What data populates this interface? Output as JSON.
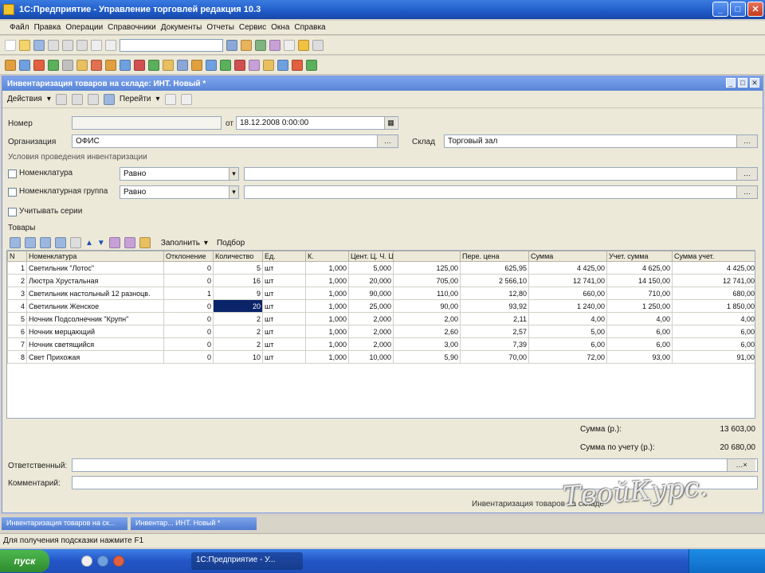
{
  "window": {
    "title": "1С:Предприятие - Управление торговлей редакция 10.3"
  },
  "menu": [
    "Файл",
    "Правка",
    "Операции",
    "Справочники",
    "Документы",
    "Отчеты",
    "Сервис",
    "Окна",
    "Справка"
  ],
  "doc": {
    "title": "Инвентаризация товаров на складе: ИНТ. Новый *",
    "actions_label": "Действия",
    "goto_label": "Перейти",
    "number_label": "Номер",
    "number_value": "",
    "date_prefix": "от",
    "date_value": "18.12.2008 0:00:00",
    "org_label": "Организация",
    "org_value": "ОФИС",
    "warehouse_label": "Склад",
    "warehouse_value": "Торговый зал",
    "section_conditions": "Условия проведения инвентаризации",
    "cond_nomenclature_label": "Номенклатура",
    "cond_nomenclature_mode": "Равно",
    "cond_group_label": "Номенклатурная группа",
    "cond_group_mode": "Равно",
    "cond_series_label": "Учитывать серии",
    "goods_label": "Товары",
    "fill_label": "Заполнить",
    "select_label": "Подбор"
  },
  "table": {
    "columns": [
      "N",
      "Номенклатура",
      "Отклонение",
      "Количество",
      "Ед.",
      "К.",
      "Цент. Ц. Ч. Цена",
      "",
      "Пере. цена",
      "Сумма",
      "Учет. сумма",
      "Сумма учет."
    ],
    "rows": [
      [
        "1",
        "Светильник \"Лотос\"",
        "0",
        "5",
        "шт",
        "1,000",
        "5,000",
        "125,00",
        "625,95",
        "4 425,00",
        "4 625,00",
        "4 425,00"
      ],
      [
        "2",
        "Люстра Хрустальная",
        "0",
        "16",
        "шт",
        "1,000",
        "20,000",
        "705,00",
        "2 566,10",
        "12 741,00",
        "14 150,00",
        "12 741,00"
      ],
      [
        "3",
        "Светильник настольный 12 разноцв.",
        "1",
        "9",
        "шт",
        "1,000",
        "90,000",
        "110,00",
        "12,80",
        "660,00",
        "710,00",
        "680,00"
      ],
      [
        "4",
        "Светильник Женское",
        "0",
        "20",
        "шт",
        "1,000",
        "25,000",
        "90,00",
        "93,92",
        "1 240,00",
        "1 250,00",
        "1 850,00"
      ],
      [
        "5",
        "Ночник Подсолнечник \"Крупн\"",
        "0",
        "2",
        "шт",
        "1,000",
        "2,000",
        "2,00",
        "2,11",
        "4,00",
        "4,00",
        "4,00"
      ],
      [
        "6",
        "Ночник мерцающий",
        "0",
        "2",
        "шт",
        "1,000",
        "2,000",
        "2,60",
        "2,57",
        "5,00",
        "6,00",
        "6,00"
      ],
      [
        "7",
        "Ночник светящийся",
        "0",
        "2",
        "шт",
        "1,000",
        "2,000",
        "3,00",
        "7,39",
        "6,00",
        "6,00",
        "6,00"
      ],
      [
        "8",
        "Свет Прихожая",
        "0",
        "10",
        "шт",
        "1,000",
        "10,000",
        "5,90",
        "70,00",
        "72,00",
        "93,00",
        "91,00"
      ]
    ]
  },
  "totals": {
    "sum_label": "Сумма (р.):",
    "sum_value": "13 603,00",
    "acct_label": "Сумма по учету (р.):",
    "acct_value": "20 680,00"
  },
  "footer": {
    "responsible_label": "Ответственный:",
    "comment_label": "Комментарий:",
    "print_label": "Инвентаризация товаров на складе"
  },
  "wintabs": [
    "Инвентаризация товаров на ск...",
    "Инвентар... ИНТ. Новый *"
  ],
  "status_text": "Для получения подсказки нажмите F1",
  "taskbar": {
    "start_label": "пуск",
    "task_label": "1С:Предприятие - У..."
  },
  "watermark": "ТвойКурс."
}
